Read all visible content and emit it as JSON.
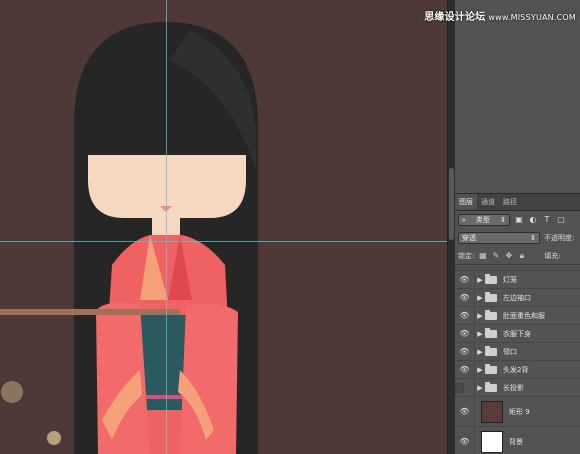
{
  "watermark": {
    "text": "思缘设计论坛",
    "site": "www.MISSYUAN.COM"
  },
  "panel": {
    "tabs": [
      "图层",
      "通道",
      "路径"
    ],
    "active_tab": 0,
    "filter_label": "类型",
    "blend_mode": "穿透",
    "opacity_label": "不透明度:",
    "lock_label": "锁定:",
    "fill_label": "填充:"
  },
  "layers": [
    {
      "name": "灯笼",
      "type": "group",
      "visible": true
    },
    {
      "name": "左边袖口",
      "type": "group",
      "visible": true
    },
    {
      "name": "肚面重色和服",
      "type": "group",
      "visible": true
    },
    {
      "name": "衣服下身",
      "type": "group",
      "visible": true
    },
    {
      "name": "领口",
      "type": "group",
      "visible": true
    },
    {
      "name": "头发2背",
      "type": "group",
      "visible": true
    },
    {
      "name": "长投影",
      "type": "group",
      "visible": false
    },
    {
      "name": "矩形 9",
      "type": "shape",
      "visible": true,
      "thumb_color": "#5a3a3a"
    },
    {
      "name": "背景",
      "type": "layer",
      "visible": true,
      "thumb_color": "#ffffff"
    }
  ],
  "colors": {
    "canvas_bg": "#4f3838",
    "hair": "#262626",
    "skin": "#f5d8bf",
    "kimono": "#f06262",
    "guide": "#5fc6c6"
  }
}
